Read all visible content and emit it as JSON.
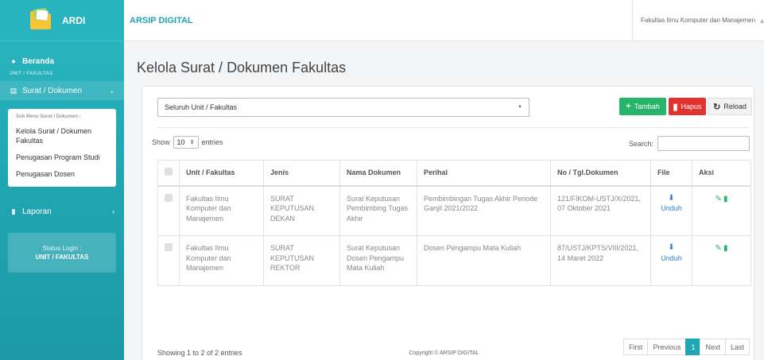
{
  "sidebar": {
    "brand": "ARDI",
    "beranda": "Beranda",
    "section_label": "UNIT / FAKULTAS",
    "surat_menu": "Surat / Dokumen",
    "submenu_head": "Sub Menu Surat / Dokumen :",
    "submenu_items": [
      "Kelola Surat / Dokumen Fakultas",
      "Penugasan Program Studi",
      "Penugasan Dosen"
    ],
    "laporan": "Laporan",
    "status_label": "Status Login :",
    "status_value": "UNIT / FAKULTAS"
  },
  "topbar": {
    "app_name": "ARSIP DIGITAL",
    "user": "Fakultas Ilmu Komputer dan Manajemen"
  },
  "page": {
    "title": "Kelola Surat / Dokumen Fakultas"
  },
  "toolbar": {
    "filter_value": "Seluruh Unit / Fakultas",
    "tambah": "Tambah",
    "hapus": "Hapus",
    "reload": "Reload"
  },
  "table_controls": {
    "show": "Show",
    "entries_value": "10",
    "entries": "entries",
    "search": "Search:"
  },
  "table": {
    "headers": [
      "Unit / Fakultas",
      "Jenis",
      "Nama Dokumen",
      "Perihal",
      "No / Tgl.Dokumen",
      "File",
      "Aksi"
    ],
    "rows": [
      {
        "unit": "Fakultas Ilmu Komputer dan Manajemen",
        "jenis": "SURAT KEPUTUSAN DEKAN",
        "nama": "Surat Keputusan Pembimbing Tugas Akhir",
        "perihal": "Pembimbingan Tugas Akhir Periode Ganjil 2021/2022",
        "no": "121/FIKOM-USTJ/X/2021, 07 Oktober 2021",
        "file": "Unduh"
      },
      {
        "unit": "Fakultas Ilmu Komputer dan Manajemen",
        "jenis": "SURAT KEPUTUSAN REKTOR",
        "nama": "Surat Keputusan Dosen Pengampu Mata Kuliah",
        "perihal": "Dosen Pengampu Mata Kuliah",
        "no": "87/USTJ/KPTS/VIII/2021, 14 Maret 2022",
        "file": "Unduh"
      }
    ]
  },
  "footer_info": {
    "showing": "Showing 1 to 2 of 2 entries",
    "pages": [
      "First",
      "Previous",
      "1",
      "Next",
      "Last"
    ],
    "active_page": "1"
  },
  "copyright": "Copyright © ARSIP DIGITAL",
  "colors": {
    "accent": "#1fa6b2",
    "success": "#26b36a",
    "danger": "#e2322e",
    "link": "#2b7fd0"
  }
}
